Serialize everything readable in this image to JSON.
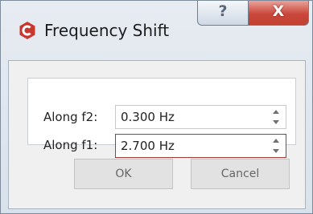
{
  "window": {
    "title": "Frequency Shift",
    "help_glyph": "?",
    "close_glyph": "X",
    "app_icon": "app-logo-icon",
    "colors": {
      "app_icon": "#c8382e",
      "close_button": "#c9463a",
      "focus_border": "#a23a3a"
    }
  },
  "fields": {
    "f2": {
      "label": "Along f2:",
      "value": "0.300 Hz"
    },
    "f1": {
      "label": "Along f1:",
      "value": "2.700 Hz"
    }
  },
  "buttons": {
    "ok": "OK",
    "cancel": "Cancel"
  }
}
